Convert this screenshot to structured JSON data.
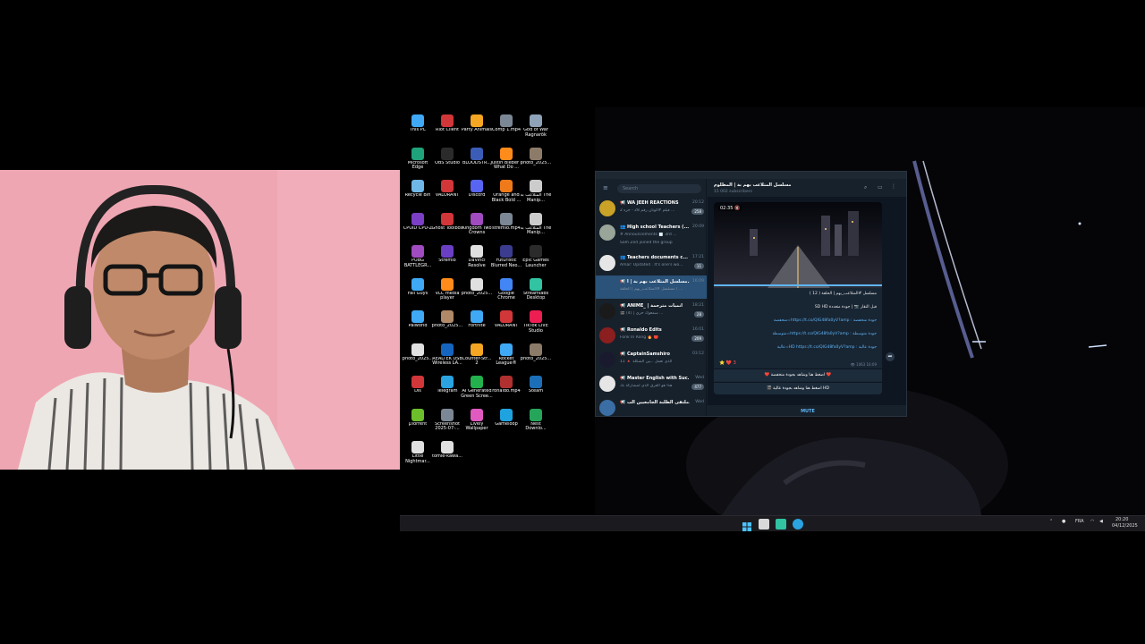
{
  "desktop": {
    "icons": [
      {
        "label": "This PC",
        "color": "#3fa9f5"
      },
      {
        "label": "Riot Client",
        "color": "#d13639"
      },
      {
        "label": "Party Animals",
        "color": "#f5a623"
      },
      {
        "label": "Comp 1.mp4",
        "color": "#7b8794"
      },
      {
        "label": "God of War Ragnarök",
        "color": "#8fa3b8"
      },
      {
        "label": "Microsoft Edge",
        "color": "#1fa37a"
      },
      {
        "label": "OBS Studio",
        "color": "#2b2b2b"
      },
      {
        "label": "BLOODSTR...",
        "color": "#3b5db8"
      },
      {
        "label": "Justin Bieber - What Do ...",
        "color": "#ff8c1a"
      },
      {
        "label": "photo_2025...",
        "color": "#8d7b6a"
      },
      {
        "label": "Recycle Bin",
        "color": "#6fb7e6"
      },
      {
        "label": "VALORANT",
        "color": "#d13639"
      },
      {
        "label": "Discord",
        "color": "#5865f2"
      },
      {
        "label": "Orange and Black Bold ...",
        "color": "#f07a1a"
      },
      {
        "label": "المتلاعب به The Manip...",
        "color": "#cccccc"
      },
      {
        "label": "CPUID CPU-Z",
        "color": "#7a3fc4"
      },
      {
        "label": "Ghost Toolbox",
        "color": "#d13639"
      },
      {
        "label": "Kingdom Two Crowns",
        "color": "#a04bbf"
      },
      {
        "label": "stremio.mp4",
        "color": "#7b8794"
      },
      {
        "label": "المتلاعب به The Manip...",
        "color": "#cccccc"
      },
      {
        "label": "PUBG BATTLEGR...",
        "color": "#a04bbf"
      },
      {
        "label": "Stremio",
        "color": "#6a3fc4"
      },
      {
        "label": "DaVinci Resolve",
        "color": "#e0e0e0"
      },
      {
        "label": "Futuristic Blurred Neo...",
        "color": "#3b3b8f"
      },
      {
        "label": "Epic Games Launcher",
        "color": "#2b2b2b"
      },
      {
        "label": "Fall Guys",
        "color": "#3fa9f5"
      },
      {
        "label": "VLC media player",
        "color": "#ff8c1a"
      },
      {
        "label": "photo_2025...",
        "color": "#e0e0e0"
      },
      {
        "label": "Google Chrome",
        "color": "#4285f4"
      },
      {
        "label": "Streamlabs Desktop",
        "color": "#31c3a2"
      },
      {
        "label": "Palworld",
        "color": "#3fa9f5"
      },
      {
        "label": "photo_2025...",
        "color": "#b08968"
      },
      {
        "label": "Fortnite",
        "color": "#3fa9f5"
      },
      {
        "label": "VALORANT",
        "color": "#d13639"
      },
      {
        "label": "TikTok LIVE Studio",
        "color": "#ee1d52"
      },
      {
        "label": "photo_2025...",
        "color": "#e0e0e0"
      },
      {
        "label": "REALTEK USB Wireless LA...",
        "color": "#1565c0"
      },
      {
        "label": "Counter-Str... 2",
        "color": "#f5a623"
      },
      {
        "label": "Rocket League®",
        "color": "#3fa9f5"
      },
      {
        "label": "photo_2025...",
        "color": "#8d7b6a"
      },
      {
        "label": "Dis",
        "color": "#d13639"
      },
      {
        "label": "Telegram",
        "color": "#2aa3e0"
      },
      {
        "label": "AI Generated Green Scree...",
        "color": "#22b14c"
      },
      {
        "label": "ronaldo.mp4",
        "color": "#b03030"
      },
      {
        "label": "Steam",
        "color": "#1b6fb8"
      },
      {
        "label": "µTorrent",
        "color": "#6cbf2a"
      },
      {
        "label": "Screenshot 2025-07-...",
        "color": "#7b8794"
      },
      {
        "label": "Lively Wallpaper",
        "color": "#e05ac0"
      },
      {
        "label": "Gameloop",
        "color": "#1fa3e0"
      },
      {
        "label": "Nest Downlo...",
        "color": "#25a55a"
      },
      {
        "label": "Little Nightmar...",
        "color": "#e0e0e0"
      },
      {
        "label": "tomie-kawa...",
        "color": "#e0e0e0"
      }
    ]
  },
  "telegram": {
    "search_placeholder": "Search",
    "channel_title": "مسلسل المتلاعب بهم بة | المظلوم",
    "channel_subscribers": "15 002 subscribers",
    "chats": [
      {
        "name": "📢 WA JEEH REACTIONS",
        "msg": "فيلم #كونان رقم 28 - جزء 2 ...",
        "time": "20:12",
        "badge": "258",
        "color": "#c9a227"
      },
      {
        "name": "👥 High school Teachers (...",
        "msg": "# Announcements 📄 3rd ...",
        "time": "20:09",
        "badge": "",
        "color": "#9aa59a"
      },
      {
        "name": "",
        "msg": "Sam Zed joined the group",
        "time": "",
        "badge": "",
        "color": ""
      },
      {
        "name": "👥 Teachers documents c...",
        "msg": "Amar: Updated . It's one's wo...",
        "time": "17:21",
        "badge": "11",
        "color": "#e6e6e6"
      },
      {
        "name": "📢 مسلسل المتلاعب بهم بة | ا...",
        "msg": "مسلسل #المتلاعب_بهم | الحلقة ( ...",
        "time": "16:09",
        "badge": "",
        "color": "#2b5278"
      },
      {
        "name": "📢 ANIME_ | انميات مترجمة",
        "msg": "🎬 (4) | سمعوك حزي ...",
        "time": "18:21",
        "badge": "28",
        "color": "#1a1a1a"
      },
      {
        "name": "📢 Ronaldo Edits",
        "msg": "Fonk In Rong 🔥 🔴",
        "time": "16:01",
        "badge": "209",
        "color": "#8b1e1e"
      },
      {
        "name": "📢 CaptainSamshiro",
        "msg": "الذي تعمل ..بين الشكلة 🔺 11",
        "time": "03:12",
        "badge": "",
        "color": "#1a1a2e"
      },
      {
        "name": "📢 Master English with Suc...",
        "msg": "هذا هو الفرق الذي لمشاركة بك",
        "time": "Wed",
        "badge": "477",
        "color": "#e6e6e6"
      },
      {
        "name": "📢 ملتقى الطلبة الجامعيين الب...",
        "msg": "",
        "time": "Wed",
        "badge": "",
        "color": "#3a6ea5"
      }
    ],
    "video_time": "02:35 🔇",
    "message_lines": [
      {
        "text": "مسلسل #المتلاعب_بهم | الحلقة ( 12 )",
        "link": false
      },
      {
        "text": "قبل التقار 📷 | جودة متعددة SD HD",
        "link": false
      },
      {
        "text": "جودة منخفضة : https://t.co/QIG48fa0yV?amp=منخفضة",
        "link": true
      },
      {
        "text": "جودة متوسطة : https://t.co/QIG48fa0yV?amp=متوسطة",
        "link": true
      },
      {
        "text": "جودة عالية : HD https://t.co/QIG48fa0yV?amp=عالية",
        "link": true
      }
    ],
    "reactions": "⭐ ❤️ 3",
    "views": "👁 1063 16:09",
    "button_low": "❤️ اضغط هنا وشاهد بجودة منخفضة ❤️",
    "button_high": "🎬 اضغط هنا وشاهد بجودة عالية HD",
    "mute_label": "MUTE"
  },
  "taskbar": {
    "lang": "FRA",
    "time": "20:20",
    "date": "04/12/2025"
  }
}
